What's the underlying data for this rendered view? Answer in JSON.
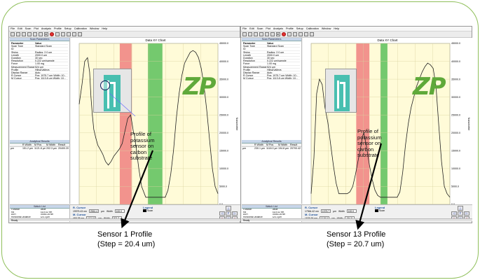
{
  "menu": [
    "File",
    "Edit",
    "Scan",
    "Plot",
    "Analysis",
    "Profile",
    "Setup",
    "Calibration",
    "Window",
    "Help"
  ],
  "scan_params": {
    "title": "Scan Parameters",
    "header": [
      "Parameter",
      "Value"
    ],
    "rows": [
      [
        "Scan Type",
        "Standard Scan"
      ],
      [
        "ID",
        ""
      ],
      [
        "Stylus",
        "Radius: 2.0 µm"
      ],
      [
        "Length",
        "2000.0 µm"
      ],
      [
        "Duration",
        "30 sec"
      ],
      [
        "Resolution",
        "0.222 µm/sample"
      ],
      [
        "Force",
        "1.00 mg"
      ],
      [
        "Measurement Range",
        "524 µm"
      ],
      [
        "Profile",
        "Hills&Valleys"
      ],
      [
        "Display Range",
        "Auto"
      ],
      [
        "R Cursor",
        "Pos: 1975.7 µm Width: 10..."
      ],
      [
        "M Cursor",
        "Pos: 1113.8 µm Width: 10..."
      ]
    ]
  },
  "analytical": {
    "title": "Analytical Results",
    "header": [
      "",
      "R Width",
      "M Pos",
      "M Width",
      "Result"
    ],
    "left_row": [
      "µm",
      "151.2 µm",
      "1121.8 µm",
      "202.3 µm",
      "20400.20 nm"
    ],
    "right_row": [
      "µm",
      "230.1 µm",
      "1118.0 µm",
      "194.8 µm",
      "20700.42 nm"
    ]
  },
  "window_list": {
    "title": "Watch List",
    "header": [
      "Function",
      "Value"
    ],
    "rows": [
      [
        "Ra",
        "5320.32 nm"
      ],
      [
        "ASH",
        "20650.28 nm"
      ],
      [
        "Horizontal Distance",
        "324.3 µm"
      ],
      [
        "Vertical Distance",
        "19912.20 nm"
      ]
    ]
  },
  "chart": {
    "title": "Data XY Chart",
    "x_label": "Micrometer",
    "y_label": "Nanometer",
    "x_ticks": [
      "0.0",
      "500.0",
      "1000.0",
      "1500.0",
      "2000.0"
    ],
    "y_ticks": [
      "45000.0",
      "40000.0",
      "35000.0",
      "30000.0",
      "25000.0",
      "20000.0",
      "15000.0",
      "10000.0",
      "5000.0",
      "0.0"
    ]
  },
  "cursors": {
    "r_label": "R. Cursor",
    "m_label": "M. Cursor",
    "legend_label": "Legend",
    "legend_item": "Scan",
    "left": {
      "r_val": "19975.43 nm",
      "r_pos": "2561.4",
      "r_width": "100.0",
      "m_val": "469.38 nm",
      "m_pos": "1121.8",
      "m_width": "202.3"
    },
    "right": {
      "r_val": "17964.42 nm",
      "r_pos": "1975.7",
      "r_width": "100.0",
      "m_val": "1529.36 nm",
      "m_pos": "1118.0",
      "m_width": "194.8"
    },
    "unit_um": "µm",
    "width_label": "Width"
  },
  "status": "Ready",
  "logo_text": "ZP",
  "annotation": "Profile of potassium sensor on carbon substrate",
  "captions": {
    "left_title": "Sensor 1 Profile",
    "left_step": "(Step = 20.4 um)",
    "right_title": "Sensor 13 Profile",
    "right_step": "(Step = 20.7 um)"
  },
  "colors": {
    "red_band": "#f08080",
    "green_band": "#5cc05c",
    "plot_bg": "#fffbd8",
    "frame": "#8fbf5a"
  },
  "chart_data": [
    {
      "type": "line",
      "title": "Data XY Chart",
      "xlabel": "Micrometer",
      "ylabel": "Nanometer",
      "xlim": [
        0,
        2000
      ],
      "ylim": [
        0,
        45000
      ],
      "series": [
        {
          "x": [
            0,
            40,
            80,
            120,
            150,
            170,
            190,
            210,
            240,
            270,
            300,
            340,
            380,
            420,
            460,
            500,
            540,
            580,
            620,
            660,
            700,
            740,
            760,
            780,
            800,
            820,
            860,
            900,
            960,
            1000,
            1060,
            1120,
            1180,
            1240,
            1280,
            1320,
            1360,
            1400,
            1440,
            1480,
            1520,
            1560,
            1600,
            1640,
            1680,
            1720,
            1760,
            1800,
            1840,
            1880,
            1920,
            1960,
            2000
          ],
          "y": [
            28000,
            33500,
            40000,
            41000,
            37000,
            30000,
            25000,
            21000,
            18500,
            16500,
            15500,
            14000,
            12000,
            11000,
            12000,
            13500,
            14500,
            15500,
            17000,
            20500,
            24000,
            25000,
            23000,
            20500,
            19000,
            16000,
            10000,
            5000,
            2000,
            2000,
            2000,
            2000,
            2000,
            2000,
            4000,
            8500,
            15000,
            24000,
            31000,
            36000,
            39500,
            41000,
            42500,
            43000,
            42500,
            41000,
            38000,
            33000,
            26000,
            18000,
            10000,
            5000,
            3000
          ]
        }
      ]
    },
    {
      "type": "line",
      "title": "Data XY Chart",
      "xlabel": "Micrometer",
      "ylabel": "Nanometer",
      "xlim": [
        0,
        2000
      ],
      "ylim": [
        0,
        45000
      ],
      "series": [
        {
          "x": [
            0,
            40,
            80,
            120,
            160,
            200,
            240,
            280,
            320,
            360,
            400,
            440,
            480,
            520,
            560,
            600,
            640,
            680,
            720,
            740,
            760,
            780,
            800,
            840,
            880,
            920,
            960,
            1000,
            1060,
            1120,
            1180,
            1240,
            1280,
            1320,
            1360,
            1400,
            1440,
            1480,
            1520,
            1560,
            1600,
            1640,
            1680,
            1720,
            1760,
            1800,
            1840,
            1880,
            1920,
            1960,
            2000
          ],
          "y": [
            3000,
            13000,
            31000,
            35000,
            33500,
            27000,
            23000,
            17000,
            11000,
            6000,
            3000,
            3000,
            3000,
            3000,
            3500,
            5000,
            8500,
            12500,
            16500,
            19000,
            20000,
            18000,
            16000,
            11000,
            7000,
            4000,
            2500,
            2000,
            2000,
            2000,
            2000,
            2000,
            3500,
            9000,
            16500,
            22500,
            27000,
            30000,
            33000,
            35000,
            37000,
            38500,
            39500,
            39000,
            38000,
            33000,
            22000,
            12000,
            5000,
            3000,
            2000
          ]
        }
      ]
    }
  ]
}
